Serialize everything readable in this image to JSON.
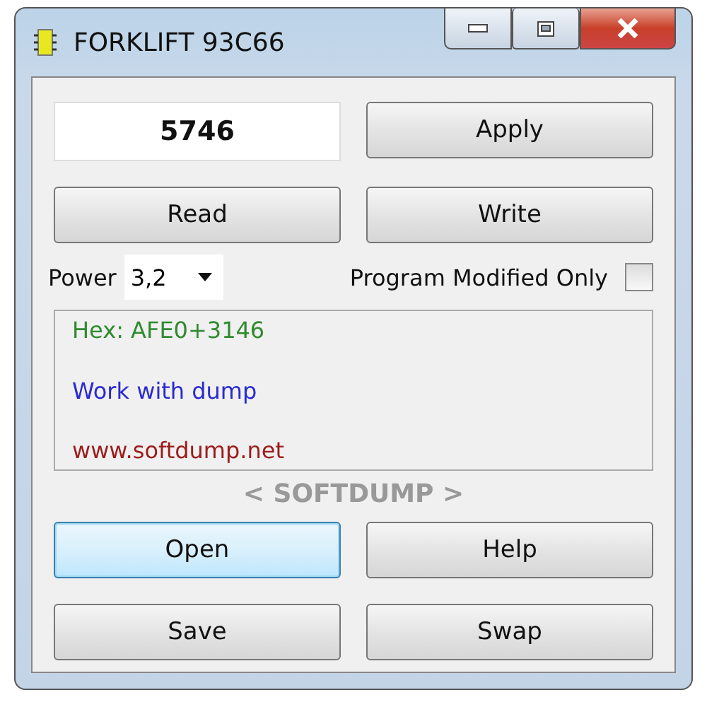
{
  "window": {
    "title": "FORKLIFT 93C66"
  },
  "value_field": {
    "value": "5746"
  },
  "apply_button": {
    "label": "Apply",
    "focused": false
  },
  "read_buttons": [
    {
      "label": "Read",
      "focused": false
    },
    {
      "label": "Write",
      "focused": false
    }
  ],
  "power": {
    "label": "Power",
    "value": "3,2"
  },
  "program_modified_only": {
    "label": "Program Modified Only",
    "checked": false
  },
  "log": [
    {
      "text": "Hex: AFE0+3146",
      "color": "#2e8b2e"
    },
    {
      "text": "Work with dump",
      "color": "#2a2ad0"
    },
    {
      "text": "www.softdump.net",
      "color": "#9b1c1c"
    }
  ],
  "brand": "< SOFTDUMP >",
  "bottom_buttons": [
    {
      "label": "Open",
      "focused": true
    },
    {
      "label": "Help",
      "focused": false
    },
    {
      "label": "Save",
      "focused": false
    },
    {
      "label": "Swap",
      "focused": false
    }
  ]
}
